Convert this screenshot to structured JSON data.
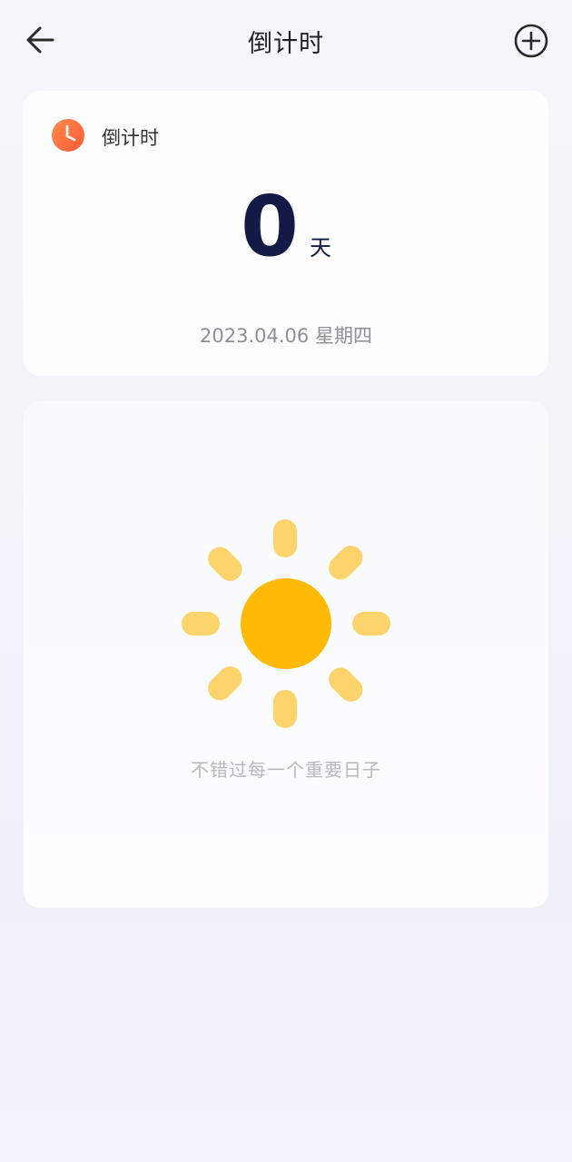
{
  "header": {
    "title": "倒计时",
    "back_icon": "arrow-left-icon",
    "add_icon": "plus-circle-icon"
  },
  "countdown_card": {
    "label": "倒计时",
    "icon": "clock-icon",
    "days": "0",
    "unit": "天",
    "date": "2023.04.06 星期四"
  },
  "empty_state": {
    "illustration": "sun-icon",
    "text": "不错过每一个重要日子"
  },
  "colors": {
    "accent_orange": "#ff7040",
    "sun_core": "#ffba08",
    "sun_rays": "#fdd46c",
    "days_text": "#141a46"
  }
}
